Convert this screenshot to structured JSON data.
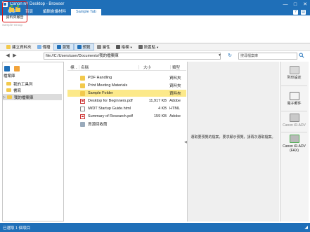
{
  "window": {
    "title": "Canon iW Desktop - Browser",
    "controls": [
      "—",
      "□",
      "✕"
    ]
  },
  "ribbon": {
    "tabs": [
      "檔案",
      "首頁",
      "編輯會議材料",
      "Sample Tab"
    ],
    "active_tab": "Sample Tab",
    "custom_button_label": "資料夾報告",
    "group_label": "Sample Group",
    "right_icons": [
      "?",
      "▤"
    ]
  },
  "toolbar": {
    "items": [
      "建立資料夾",
      "傳播",
      "瀏覽",
      "預覽",
      "屬性",
      "格欄",
      "設置點"
    ]
  },
  "address": {
    "back": "◀",
    "forward": "▶",
    "path": "file://C:/Users/user/Documents/我的檔案庫",
    "refresh": "↻",
    "search_placeholder": "搜尋檔案庫",
    "search_icon": "magnifier-icon"
  },
  "nav": {
    "header": "檔案庫",
    "items": [
      {
        "label": "我的工具列",
        "selected": false
      },
      {
        "label": "書寫",
        "selected": false
      },
      {
        "label": "我的檔案庫",
        "selected": true
      }
    ]
  },
  "list": {
    "columns": [
      "標…",
      "名稱",
      "大小",
      "類型"
    ],
    "rows": [
      {
        "name": "PDF Handling",
        "size": "",
        "type": "資料夾",
        "icon": "folder",
        "selected": false
      },
      {
        "name": "Print Meeting Materials",
        "size": "",
        "type": "資料夾",
        "icon": "folder",
        "selected": false
      },
      {
        "name": "Sample Folder",
        "size": "",
        "type": "資料夾",
        "icon": "folder",
        "selected": true
      },
      {
        "name": "Desktop for Beginners.pdf",
        "size": "11,917 KB",
        "type": "Adobe",
        "icon": "pdf",
        "selected": false
      },
      {
        "name": "iWDT Startup Guide.html",
        "size": "4 KB",
        "type": "HTML",
        "icon": "html",
        "selected": false
      },
      {
        "name": "Summary of Research.pdf",
        "size": "159 KB",
        "type": "Adobe",
        "icon": "pdf",
        "selected": false
      },
      {
        "name": "資源回收筒",
        "size": "",
        "type": "",
        "icon": "trash",
        "selected": false
      }
    ]
  },
  "preview": {
    "message": "選取要預覽的檔案，要求顯示預覽，請再次選取檔案。"
  },
  "output_bar": {
    "buttons": [
      {
        "label": "列印設定"
      },
      {
        "label": "電子郵件"
      },
      {
        "label": "Canon iR-ADV"
      },
      {
        "label": "Canon iR-ADV (FAX)"
      }
    ]
  },
  "status": {
    "text": "已選取 1 個項目"
  },
  "colors": {
    "accent": "#1f6fb8",
    "highlight": "#d11111",
    "selection": "#fce98a"
  }
}
